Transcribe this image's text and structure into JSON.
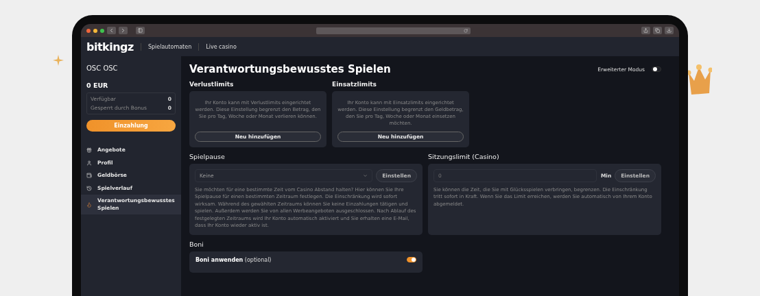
{
  "site_header": {
    "logo": "bitkingz",
    "nav": [
      {
        "label": "Spielautomaten"
      },
      {
        "label": "Live casino"
      }
    ]
  },
  "sidebar": {
    "user": "OSC OSC",
    "balance": "0 EUR",
    "balance_rows": [
      {
        "label": "Verfügbar",
        "value": "0"
      },
      {
        "label": "Gesperrt durch Bonus",
        "value": "0"
      }
    ],
    "deposit_button": "Einzahlung",
    "items": [
      {
        "label": "Angebote",
        "selected": false
      },
      {
        "label": "Profil",
        "selected": false
      },
      {
        "label": "Geldbörse",
        "selected": false
      },
      {
        "label": "Spielverlauf",
        "selected": false
      },
      {
        "label": "Verantwortungsbewusstes Spielen",
        "selected": true
      }
    ]
  },
  "page": {
    "title": "Verantwortungsbewusstes Spielen",
    "advanced_mode": {
      "label": "Erweiterter Modus",
      "on": false
    },
    "limit_cards": [
      {
        "heading": "Verlustlimits",
        "text": "Ihr Konto kann mit Verlustlimits eingerichtet werden. Diese Einstellung begrenzt den Betrag, den Sie pro Tag, Woche oder Monat verlieren können.",
        "button": "Neu hinzufügen"
      },
      {
        "heading": "Einsatzlimits",
        "text": "Ihr Konto kann mit Einsatzlimits eingerichtet werden. Diese Einstellung begrenzt den Geldbetrag, den Sie pro Tag, Woche oder Monat einsetzen möchten.",
        "button": "Neu hinzufügen"
      }
    ],
    "setting_cards": [
      {
        "kind": "select",
        "heading": "Spielpause",
        "value": "Keine",
        "button": "Einstellen",
        "text": "Sie möchten für eine bestimmte Zeit vom Casino Abstand halten? Hier können Sie Ihre Spielpause für einen bestimmten Zeitraum festlegen. Die Einschränkung wird sofort wirksam. Während des gewählten Zeitraums können Sie keine Einzahlungen tätigen und spielen. Außerdem werden Sie von allen Werbeangeboten ausgeschlossen. Nach Ablauf des festgelegten Zeitraums wird Ihr Konto automatisch aktiviert und Sie erhalten eine E-Mail, dass Ihr Konto wieder aktiv ist."
      },
      {
        "kind": "number",
        "heading": "Sitzungslimit (Casino)",
        "placeholder": "0",
        "unit": "Min",
        "button": "Einstellen",
        "text": "Sie können die Zeit, die Sie mit Glücksspielen verbringen, begrenzen. Die Einschränkung tritt sofort in Kraft. Wenn Sie das Limit erreichen, werden Sie automatisch von Ihrem Konto abgemeldet."
      }
    ],
    "bonus": {
      "heading": "Boni",
      "label": "**Boni anwenden** (optional)",
      "on": true
    }
  }
}
